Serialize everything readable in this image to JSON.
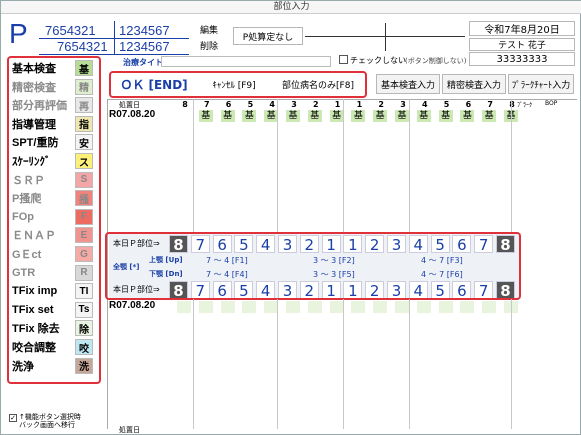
{
  "window": {
    "title": "部位入力"
  },
  "header": {
    "p_letter": "P",
    "id_a1": "7654321",
    "id_a2": "7654321",
    "id_b1": "1234567",
    "id_b2": "1234567",
    "edit": "編集",
    "delete": "削除",
    "p_status": "P処算定なし",
    "date": "令和7年8月20日",
    "patient_name": "テスト 花子",
    "patient_number": "33333333",
    "chk_label": "チェックしない",
    "chk_hint": "(ボタン制御しない)",
    "treatment_title": "治療タイトル"
  },
  "toolbar": {
    "ok": "ＯＫ [END]",
    "cancel": "ｷｬﾝｾﾙ [F9]",
    "partname": "部位病名のみ[F8]",
    "basic": "基本検査入力",
    "detail": "精密検査入力",
    "plaque": "ﾌﾟﾗｰｸﾁｬｰﾄ入力"
  },
  "sidebar": {
    "items": [
      {
        "label": "基本検査",
        "badge": "基",
        "color": "#b7dc98",
        "text": "#000",
        "enabled": true
      },
      {
        "label": "精密検査",
        "badge": "精",
        "color": "#dfeecf",
        "text": "#888",
        "enabled": false
      },
      {
        "label": "部分再評価",
        "badge": "再",
        "color": "#e8e8e8",
        "text": "#888",
        "enabled": false
      },
      {
        "label": "指導管理",
        "badge": "指",
        "color": "#eee8b0",
        "text": "#000",
        "enabled": true
      },
      {
        "label": "SPT/重防",
        "badge": "安",
        "color": "#f4f4f4",
        "text": "#000",
        "enabled": true
      },
      {
        "label": "ｽｹｰﾘﾝｸﾞ",
        "badge": "ス",
        "color": "#fbf17a",
        "text": "#000",
        "enabled": true
      },
      {
        "label": "ＳＲＰ",
        "badge": "S",
        "color": "#f4a6a6",
        "text": "#888",
        "enabled": false
      },
      {
        "label": "P搔爬",
        "badge": "掻",
        "color": "#f2827c",
        "text": "#888",
        "enabled": false
      },
      {
        "label": "FOp",
        "badge": "F",
        "color": "#ee6b62",
        "text": "#888",
        "enabled": false
      },
      {
        "label": "ＥＮＡＰ",
        "badge": "E",
        "color": "#f19490",
        "text": "#888",
        "enabled": false
      },
      {
        "label": "GＥct",
        "badge": "G",
        "color": "#f6aaa6",
        "text": "#888",
        "enabled": false
      },
      {
        "label": "GTR",
        "badge": "R",
        "color": "#d8d8d8",
        "text": "#888",
        "enabled": false
      },
      {
        "label": "TFix imp",
        "badge": "TI",
        "color": "#f4f4f4",
        "text": "#000",
        "enabled": true
      },
      {
        "label": "TFix set",
        "badge": "Ts",
        "color": "#f4f4f4",
        "text": "#000",
        "enabled": true
      },
      {
        "label": "TFix 除去",
        "badge": "除",
        "color": "#e9f3e1",
        "text": "#000",
        "enabled": true
      },
      {
        "label": "咬合調整",
        "badge": "咬",
        "color": "#bfe7f2",
        "text": "#000",
        "enabled": true
      },
      {
        "label": "洗浄",
        "badge": "洗",
        "color": "#c5a79a",
        "text": "#000",
        "enabled": true
      }
    ]
  },
  "chart": {
    "header_label": "処置日",
    "plaque_label": "ﾌﾟﾗｰｸ",
    "bop_label": "BOP",
    "tooth_numbers": [
      "8",
      "7",
      "6",
      "5",
      "4",
      "3",
      "2",
      "1",
      "1",
      "2",
      "3",
      "4",
      "5",
      "6",
      "7",
      "8"
    ],
    "date": "R07.08.20",
    "cell_text": "基",
    "filled_cols": [
      1,
      2,
      3,
      4,
      5,
      6,
      7,
      8,
      9,
      10,
      11,
      12,
      13,
      14,
      15
    ],
    "date2": "R07.08.20"
  },
  "part_panel": {
    "today_label": "本日Ｐ部位⇒",
    "all_label": "全顎 [*]",
    "upper_label": "上顎 [Up]",
    "lower_label": "下顎 [Dn]",
    "up1": "7 ～ 4 [F1]",
    "up2": "3 ～ 3 [F2]",
    "up3": "4 ～ 7 [F3]",
    "dn1": "7 ～ 4 [F4]",
    "dn2": "3 ～ 3 [F5]",
    "dn3": "4 ～ 7 [F6]",
    "numbers": [
      "8",
      "7",
      "6",
      "5",
      "4",
      "3",
      "2",
      "1",
      "1",
      "2",
      "3",
      "4",
      "5",
      "6",
      "7",
      "8"
    ]
  },
  "footer": {
    "check_text": "↑機能ボタン選択時\nバック画面へ移行"
  }
}
